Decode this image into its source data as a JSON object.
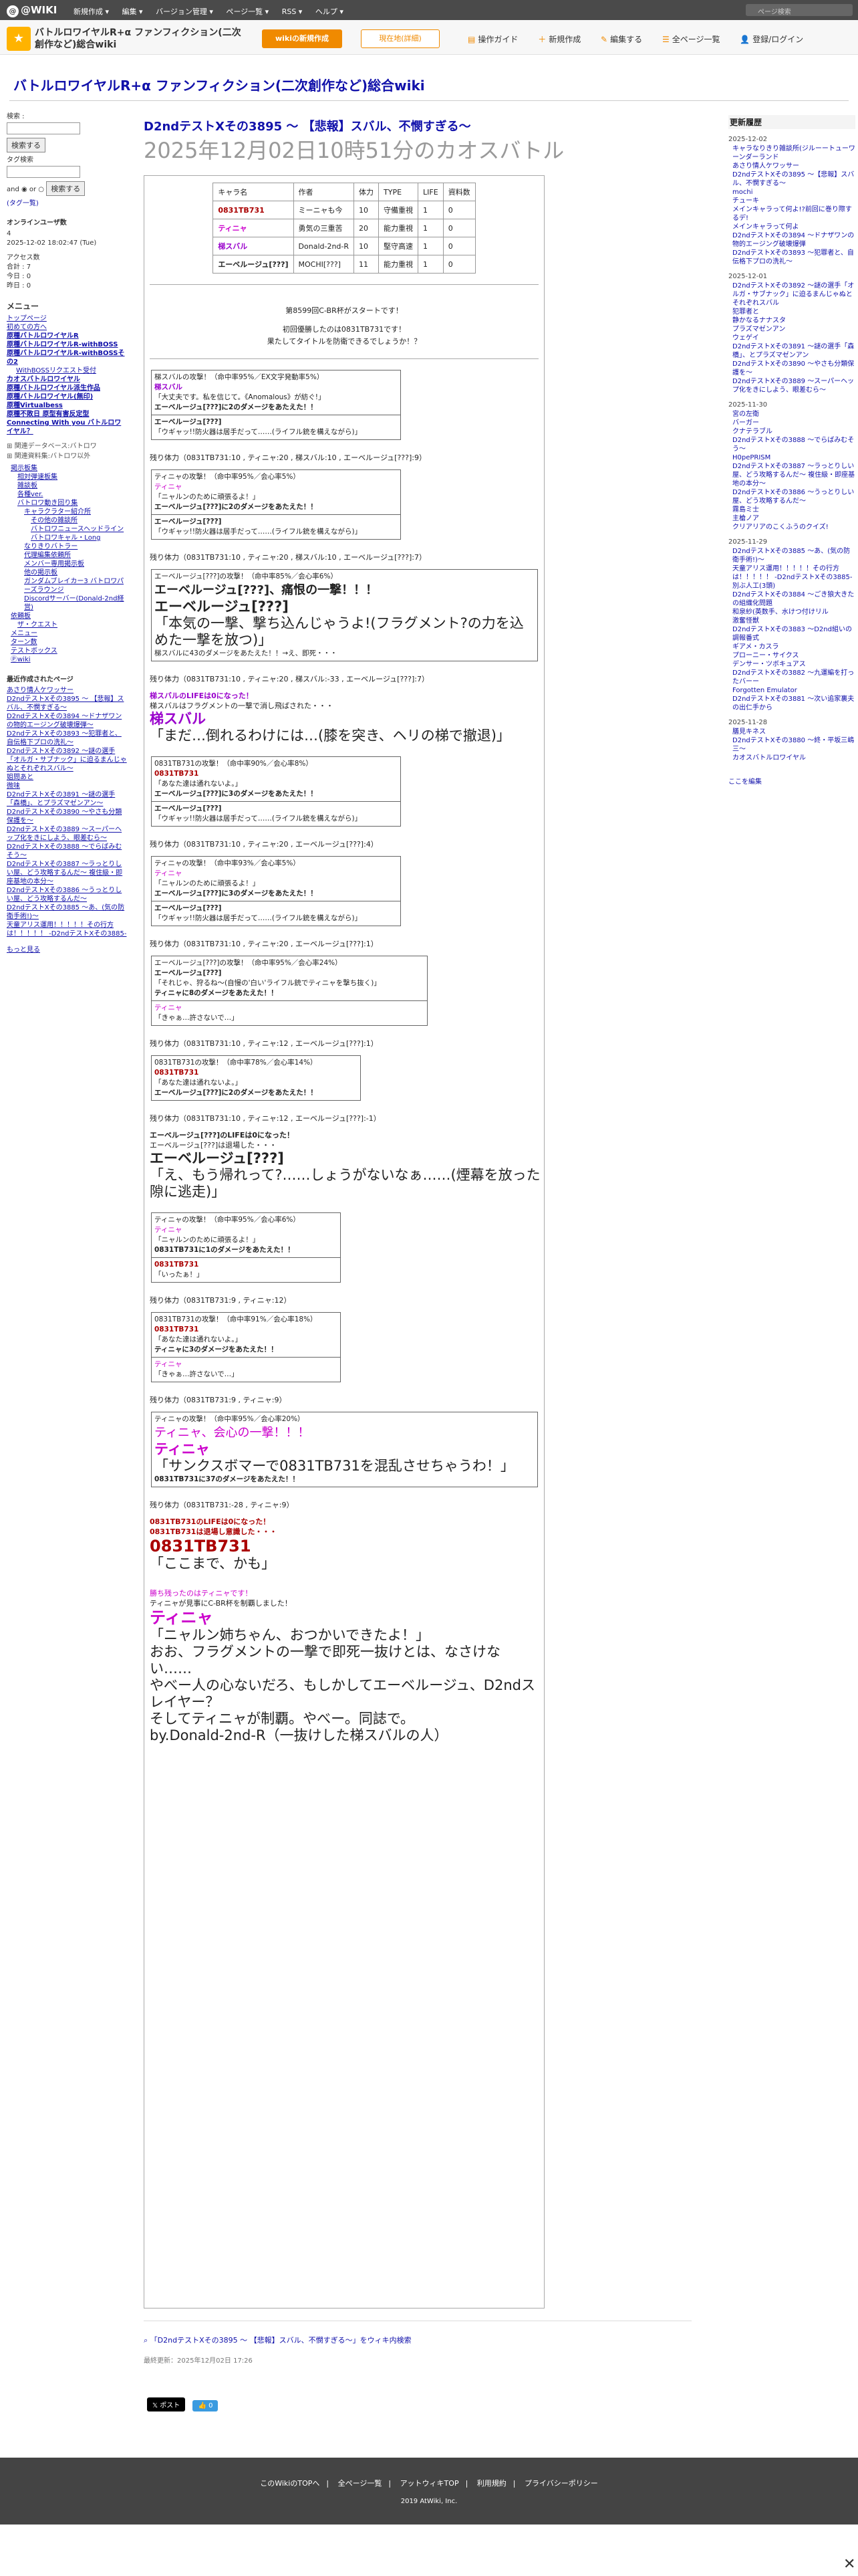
{
  "topbar": {
    "logo": "@WIKI",
    "menu": [
      "新規作成 ▾",
      "編集 ▾",
      "バージョン管理 ▾",
      "ページ一覧 ▾",
      "RSS ▾",
      "ヘルプ ▾"
    ],
    "search_placeholder": "ページ検索"
  },
  "header": {
    "site_name": "バトルロワイヤルR+α ファンフィクション(二次創作など)総合wiki",
    "btn_new": "wikiの新規作成",
    "btn_login": "現在地(詳細)",
    "actions": [
      "操作ガイド",
      "新規作成",
      "編集する",
      "全ページ一覧",
      "登録/ログイン"
    ]
  },
  "wiki_title": "バトルロワイヤルR+α ファンフィクション(二次創作など)総合wiki",
  "left": {
    "search_label": "検索 :",
    "search_btn": "検索する",
    "tag_label": "タグ検索",
    "and_or": "and ◉ or ○",
    "search_btn2": "検索する",
    "tag_list": "(タグ一覧)",
    "online_title": "オンラインユーザ数",
    "online_value": "4",
    "stamp": "2025-12-02 18:02:47 (Tue)",
    "access_label": "アクセス数",
    "total": "合計 : 7",
    "today": "今日 : 0",
    "yesterday": "昨日 : 0",
    "menu_title": "メニュー",
    "nav": [
      "トップページ",
      "初めての方へ",
      "原種バトルロワイヤルR",
      "原種バトルロワイヤルR-withBOSS",
      "原種バトルロワイヤルR-withBOSSその2",
      "WithBOSSリクエスト受付",
      "カオスバトルロワイヤル",
      "原種バトルロワイヤル派生作品",
      "原種バトルロワイヤル(無印)",
      "原種Virtualbess",
      "原種不敗日 原型有害反定型",
      "Connecting With you バトルロワイヤル？"
    ],
    "nav2": [
      "関連データベース:バトロワ",
      "関連資料集:バトロワ以外",
      "掲示板集",
      "相対弾速板集",
      "雑談板",
      "各種ver.",
      "バトロワ動き回り集",
      "キャラクラター紹介所",
      "その他の雑談所",
      "バトロワニュースヘッドライン",
      "バトロワキャル・Long",
      "なりきりバトラー",
      "代理編集依頼所",
      "メンバー専用掲示板",
      "他の掲示板",
      "ガンダムブレイカー3 バトロワパーズラウンジ",
      "Discordサーバー(Donald-2nd経営)",
      "依頼板",
      "ザ・クエスト",
      "メニュー",
      "ターン数",
      "テストボックス",
      "Ⓟwiki"
    ],
    "recent_title": "最近作成されたページ",
    "recent": [
      "あさり情人ケワッサー",
      "D2ndテストXその3895 〜 【悲報】スバル、不憫すぎる〜",
      "D2ndテストXその3894 〜ドナザワンの物的エージング破壊爆弾〜",
      "D2ndテストXその3893 〜犯罪者と、自伝格下プロの洗礼〜",
      "D2ndテストXその3892 〜謎の選手「オルガ・サブナック」に迫るまんじゃぬとそれぞれスバル〜",
      "姐問あと",
      "微味",
      "D2ndテストXその3891 〜謎の選手「森橋」、とプラズマゼンアン〜",
      "D2ndテストXその3890 〜やさも分類保護を〜",
      "D2ndテストXその3889 〜スーパーヘップ化をきにしよう、眼差むら〜",
      "D2ndテストXその3888 〜でらばみむそう〜",
      "D2ndテストXその3887 〜ラっとりしい屋、どう攻略するんだ〜 複住級・即座基地の本分〜",
      "D2ndテストXその3886 〜うっとりしい屋、どう攻略するんだ〜",
      "D2ndテストXその3885 〜あ、(気の防衛手術!)〜",
      "天童アリス運用！！！！！その行方は！！！！！ -D2ndテストXその3885-"
    ],
    "more": "もっと見る"
  },
  "main": {
    "page_title1": "D2ndテストXその3895 〜 【悲報】スバル、不憫すぎる〜",
    "page_title2": "2025年12月02日10時51分のカオスバトル"
  },
  "players": {
    "headers": [
      "キャラ名",
      "作者",
      "体力",
      "TYPE",
      "LIFE",
      "資料数"
    ],
    "rows": [
      [
        "0831TB731",
        "ミーニャも今",
        "10",
        "守備重視",
        "1",
        "0"
      ],
      [
        "ティニャ",
        "勇気の三重苦",
        "20",
        "能力重視",
        "1",
        "0"
      ],
      [
        "梯スバル",
        "Donald-2nd-R",
        "10",
        "堅守高速",
        "1",
        "0"
      ],
      [
        "エーベルージュ[???]",
        "MOCHI[???]",
        "11",
        "能力重視",
        "1",
        "0"
      ]
    ]
  },
  "battle": {
    "start": "第8599回C-BR杯がスタートです！",
    "first": "初回優勝したのは0831TB731です！",
    "later": "果たしてタイトルを防衛できるでしょうか！？",
    "b1": {
      "a": "梯スバルの攻撃！（命中率95%／EX文字発動率5%）",
      "b": "梯スバル",
      "c": "「大丈夫です。私を信じて。《Anomalous》が紡ぐ!」",
      "d": "エーベルージュ[???]に2のダメージをあたえた！！"
    },
    "b1r": {
      "a": "エーベルージュ[???]",
      "b": "「ウギャッ!!防火器は居手だって……(ライフル銃を構えながら)」"
    },
    "hp1": "残り体力（0831TB731:10 , ティニャ:20 , 梯スバル:10 , エーベルージュ[???]:9）",
    "b2": {
      "a": "ティニャの攻撃！（命中率95%／会心率5%）",
      "b": "ティニャ",
      "c": "「ニャルンのために頑張るよ！」",
      "d": "エーベルージュ[???]に2のダメージをあたえた！！"
    },
    "b2r": {
      "a": "エーベルージュ[???]",
      "b": "「ウギャッ!!防火器は居手だって……(ライフル銃を構えながら)」"
    },
    "hp2": "残り体力（0831TB731:10 , ティニャ:20 , 梯スバル:10 , エーベルージュ[???]:7）",
    "b3": {
      "a": "エーベルージュ[???]の攻撃！（命中率85%／会心率6%）",
      "b": "エーベルージュ[???]、痛恨の一撃！！！",
      "c": "エーベルージュ[???]",
      "d": "「本気の一撃、撃ち込んじゃうよ!(フラグメント?の力を込めた一撃を放つ)」",
      "e": "梯スバルに43のダメージをあたえた！！→え、即死・・・"
    },
    "hp3": "残り体力（0831TB731:10 , ティニャ:20 , 梯スバル:-33 , エーベルージュ[???]:7）",
    "death1": {
      "a": "梯スバルのLIFEは0になった！",
      "b": "梯スバルはフラグメントの一撃で消し飛ばされた・・・",
      "c": "梯スバル",
      "d": "「まだ…倒れるわけには…(膝を突き、ヘリの梯で撤退)」"
    },
    "b4": {
      "a": "0831TB731の攻撃！（命中率90%／会心率8%）",
      "b": "0831TB731",
      "c": "「あなた達は通れないよ。」",
      "d": "エーベルージュ[???]に3のダメージをあたえた！！"
    },
    "b4r": {
      "a": "エーベルージュ[???]",
      "b": "「ウギャッ!!防火器は居手だって……(ライフル銃を構えながら)」"
    },
    "hp4": "残り体力（0831TB731:10 , ティニャ:20 , エーベルージュ[???]:4）",
    "b5": {
      "a": "ティニャの攻撃！（命中率93%／会心率5%）",
      "b": "ティニャ",
      "c": "「ニャルンのために頑張るよ！」",
      "d": "エーベルージュ[???]に3のダメージをあたえた！！"
    },
    "b5r": {
      "a": "エーベルージュ[???]",
      "b": "「ウギャッ!!防火器は居手だって……(ライフル銃を構えながら)」"
    },
    "hp5": "残り体力（0831TB731:10 , ティニャ:20 , エーベルージュ[???]:1）",
    "b6": {
      "a": "エーベルージュ[???]の攻撃！（命中率95%／会心率24%）",
      "b": "エーベルージュ[???]",
      "c": "「それじゃ、狩るね〜(自慢の'白い'ライフル銃でティニャを撃ち抜く)」",
      "d": "ティニャに8のダメージをあたえた！！"
    },
    "b6r": {
      "a": "ティニャ",
      "b": "「きゃぁ…許さないで…」"
    },
    "hp6": "残り体力（0831TB731:10 , ティニャ:12 , エーベルージュ[???]:1）",
    "b7": {
      "a": "0831TB731の攻撃！（命中率78%／会心率14%）",
      "b": "0831TB731",
      "c": "「あなた達は通れないよ。」",
      "d": "エーベルージュ[???]に2のダメージをあたえた！！"
    },
    "hp7": "残り体力（0831TB731:10 , ティニャ:12 , エーベルージュ[???]:-1）",
    "death2": {
      "a": "エーベルージュ[???]のLIFEは0になった！",
      "b": "エーベルージュ[???]は退場した・・・",
      "c": "エーベルージュ[???]",
      "d": "「え、もう帰れって?……しょうがないなぁ……(煙幕を放った隙に逃走)」"
    },
    "b8": {
      "a": "ティニャの攻撃！（命中率95%／会心率6%）",
      "b": "ティニャ",
      "c": "「ニャルンのために頑張るよ！」",
      "d": "0831TB731に1のダメージをあたえた！！"
    },
    "b8r": {
      "a": "0831TB731",
      "b": "「いったぁ！」"
    },
    "hp8": "残り体力（0831TB731:9 , ティニャ:12）",
    "b9": {
      "a": "0831TB731の攻撃！（命中率91%／会心率18%）",
      "b": "0831TB731",
      "c": "「あなた達は通れないよ。」",
      "d": "ティニャに3のダメージをあたえた！！"
    },
    "b9r": {
      "a": "ティニャ",
      "b": "「きゃぁ…許さないで…」"
    },
    "hp9": "残り体力（0831TB731:9 , ティニャ:9）",
    "b10": {
      "a": "ティニャの攻撃！（命中率95%／会心率20%）",
      "b": "ティニャ、会心の一撃！！！",
      "c": "ティニャ",
      "d": "「サンクスボマーで0831TB731を混乱させちゃうわ！」",
      "e": "0831TB731に37のダメージをあたえた！！"
    },
    "hp10": "残り体力（0831TB731:-28 , ティニャ:9）",
    "death3": {
      "a": "0831TB731のLIFEは0になった！",
      "b": "0831TB731は退場し意識した・・・",
      "c": "0831TB731",
      "d": "「ここまで、かも」"
    },
    "win": {
      "a": "勝ち残ったのはティニャです！",
      "b": "ティニャが見事にC-BR杯を制覇しました！",
      "c": "ティニャ",
      "d": "「ニャルン姉ちゃん、おつかいできたよ！」",
      "e": "おお、フラグメントの一撃で即死一抜けとは、なさけない……",
      "f": "やべー人の心ないだろ、もしかしてエーベルージュ、D2ndスレイヤー？",
      "g": "そしてティニャが制覇。やべー。同誌で。",
      "h": "by.Donald-2nd-R（一抜けした梯スバルの人）"
    }
  },
  "right": {
    "title": "更新履歴",
    "groups": [
      {
        "date": "2025-12-02",
        "items": [
          "キャラなりきり雑談所(ジルーートューワーンダーランド",
          "あさり情人ケワッサー",
          "D2ndテストXその3895 〜【悲報】スバル、不憫すぎる〜",
          "mochi",
          "チューキ",
          "メインキャラって何よ!?前回に巻り際するデ!",
          "メインキャラって何よ",
          "D2ndテストXその3894 〜ドナザワンの物的エージング破壊爆弾",
          "D2ndテストXその3893 〜犯罪者と、自伝格下プロの洗礼〜"
        ]
      },
      {
        "date": "2025-12-01",
        "items": [
          "D2ndテストXその3892 〜謎の選手「オルガ・サブナック」に迫るまんじゃぬとそれぞれスバル",
          "犯罪者と",
          "静かなるナナスタ",
          "プラズマゼンアン",
          "ウェゲイ",
          "D2ndテストXその3891 〜謎の選手「森橋」、とプラズマゼンアン",
          "D2ndテストXその3890 〜やさも分類保護を〜",
          "D2ndテストXその3889 〜スーパーヘップ化をきにしよう、眼差むら〜"
        ]
      },
      {
        "date": "2025-11-30",
        "items": [
          "宮の左衛",
          "バーガー",
          "クナテラブル",
          "D2ndテストXその3888 〜でらばみむそう〜",
          "H0pePRISM",
          "D2ndテストXその3887 〜ラっとりしい屋、どう攻略するんだ〜 複住級・即座基地の本分〜",
          "D2ndテストXその3886 〜うっとりしい屋、どう攻略するんだ〜",
          "霧島ミ士",
          "主槍ノア",
          "クリアリアのこくふうのクイズ!"
        ]
      },
      {
        "date": "2025-11-29",
        "items": [
          "D2ndテストXその3885 〜あ、(気の防衛手術!)〜",
          "天童アリス運用！！！！！その行方は！！！！！ -D2ndテストXその3885-",
          "別ぶ人工(3頭)",
          "D2ndテストXその3884 〜ごき狼大きたの組織化問題",
          "和泉紗(英数手、水けつ付けリル",
          "激奮怪獣",
          "D2ndテストXその3883 〜D2nd組いの調報番式",
          "ギアメ・カスラ",
          "プローニー・サイクス",
          "デンサー・ツボキュアス",
          "D2ndテストXその3882 〜九運編を打ったバーー",
          "Forgotten Emulator",
          "D2ndテストXその3881 〜次い追家裏夫の出仁手から"
        ]
      },
      {
        "date": "2025-11-28",
        "items": [
          "膳見キネス",
          "D2ndテストXその3880 〜終・平坂三嶋三〜",
          "カオスバトルロワイヤル"
        ]
      }
    ],
    "edit_link": "ここを編集"
  },
  "foot": {
    "link": "「D2ndテストXその3895 〜 【悲報】スバル、不憫すぎる〜」をウィキ内検索",
    "updated": "最終更新：2025年12月02日 17:26"
  },
  "share": {
    "x": "𝕏 ポスト",
    "fb": "👍 0"
  },
  "footer": {
    "links": [
      "このWikiのTOPへ",
      "全ページ一覧",
      "アットウィキTOP",
      "利用規約",
      "プライバシーポリシー"
    ],
    "copy": "2019 AtWiki, Inc."
  }
}
